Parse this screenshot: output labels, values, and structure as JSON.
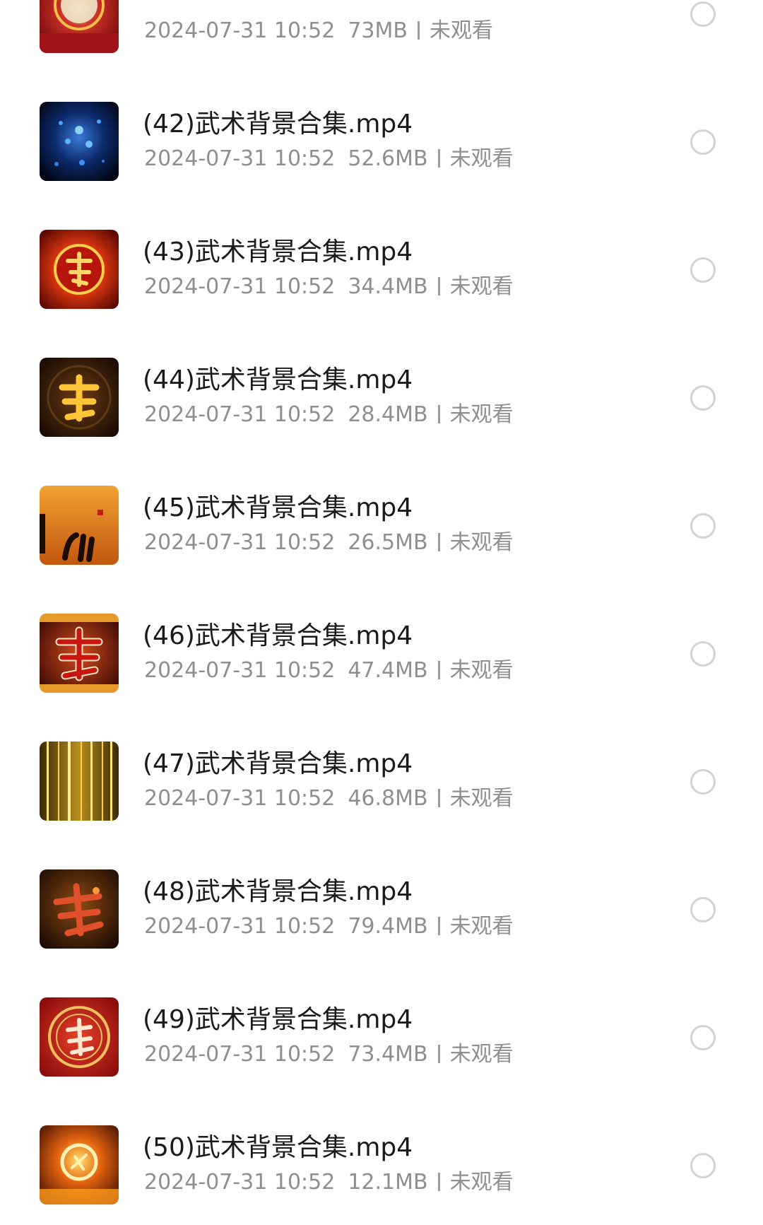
{
  "files": [
    {
      "name": "",
      "date": "2024-07-31 10:52",
      "size": "73MB",
      "status": "未观看",
      "thumb_icon": "red-gold-seal-thumbnail"
    },
    {
      "name": "(42)武术背景合集.mp4",
      "date": "2024-07-31 10:52",
      "size": "52.6MB",
      "status": "未观看",
      "thumb_icon": "blue-particles-thumbnail"
    },
    {
      "name": "(43)武术背景合集.mp4",
      "date": "2024-07-31 10:52",
      "size": "34.4MB",
      "status": "未观看",
      "thumb_icon": "fire-wu-character-circle-thumbnail"
    },
    {
      "name": "(44)武术背景合集.mp4",
      "date": "2024-07-31 10:52",
      "size": "28.4MB",
      "status": "未观看",
      "thumb_icon": "gold-wu-character-thumbnail"
    },
    {
      "name": "(45)武术背景合集.mp4",
      "date": "2024-07-31 10:52",
      "size": "26.5MB",
      "status": "未观看",
      "thumb_icon": "ink-calligraphy-thumbnail"
    },
    {
      "name": "(46)武术背景合集.mp4",
      "date": "2024-07-31 10:52",
      "size": "47.4MB",
      "status": "未观看",
      "thumb_icon": "red-wu-character-thumbnail"
    },
    {
      "name": "(47)武术背景合集.mp4",
      "date": "2024-07-31 10:52",
      "size": "46.8MB",
      "status": "未观看",
      "thumb_icon": "gold-streaks-thumbnail"
    },
    {
      "name": "(48)武术背景合集.mp4",
      "date": "2024-07-31 10:52",
      "size": "79.4MB",
      "status": "未观看",
      "thumb_icon": "fiery-wu-character-thumbnail"
    },
    {
      "name": "(49)武术背景合集.mp4",
      "date": "2024-07-31 10:52",
      "size": "73.4MB",
      "status": "未观看",
      "thumb_icon": "red-emblem-thumbnail"
    },
    {
      "name": "(50)武术背景合集.mp4",
      "date": "2024-07-31 10:52",
      "size": "12.1MB",
      "status": "未观看",
      "thumb_icon": "fire-ring-thumbnail"
    }
  ]
}
